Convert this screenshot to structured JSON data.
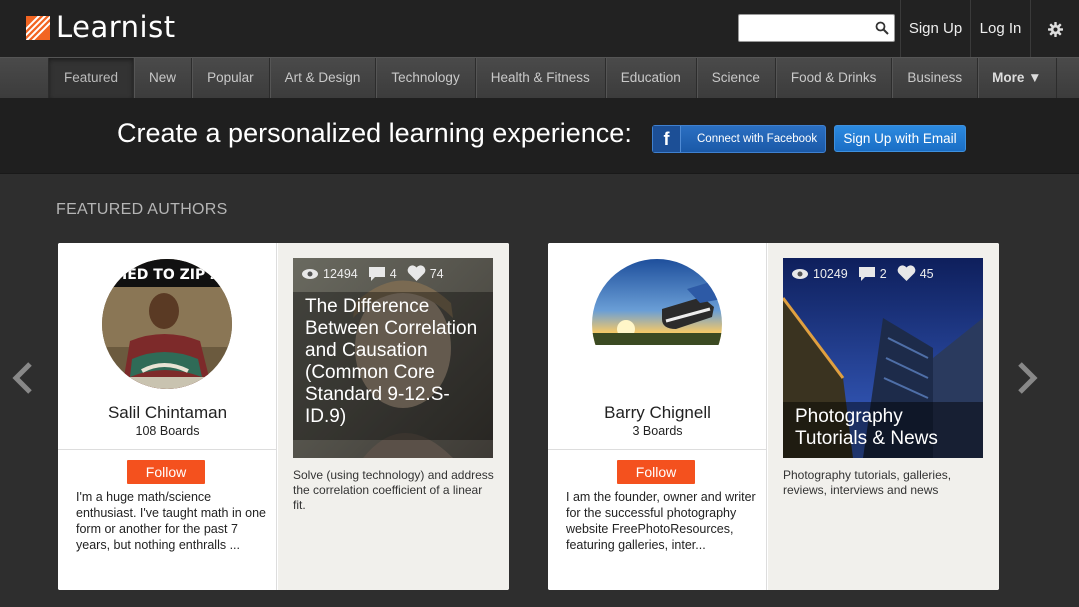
{
  "header": {
    "logo_text": "Learnist",
    "search_placeholder": "",
    "signup": "Sign Up",
    "login": "Log In"
  },
  "nav": {
    "items": [
      "Featured",
      "New",
      "Popular",
      "Art & Design",
      "Technology",
      "Health & Fitness",
      "Education",
      "Science",
      "Food & Drinks",
      "Business"
    ],
    "more": "More ▼",
    "active": "Featured"
  },
  "banner": {
    "text": "Create a personalized learning experience:",
    "facebook": "Connect with Facebook",
    "email": "Sign Up with Email"
  },
  "featured": {
    "title": "FEATURED AUTHORS",
    "authors": [
      {
        "name": "Salil Chintaman",
        "boards": "108 Boards",
        "follow": "Follow",
        "bio": "I'm a huge math/science enthusiast. I've taught math in one form or another for the past 7 years, but nothing enthralls ...",
        "board": {
          "views": "12494",
          "comments": "4",
          "likes": "74",
          "title": "The Difference Between Correlation and Causation (Common Core Standard 9-12.S-ID.9)",
          "desc": "Solve (using technology) and address the correlation coefficient of a linear fit."
        }
      },
      {
        "name": "Barry Chignell",
        "boards": "3 Boards",
        "follow": "Follow",
        "bio": "I am the founder, owner and writer for the successful photography website FreePhotoResources, featuring galleries, inter...",
        "board": {
          "views": "10249",
          "comments": "2",
          "likes": "45",
          "title": "Photography Tutorials & News",
          "desc": "Photography tutorials, galleries, reviews, interviews and news"
        }
      }
    ]
  },
  "colors": {
    "accent": "#f4511e",
    "facebook": "#1a59a8",
    "email_button": "#1a6ec5",
    "background": "#2e2e2e"
  }
}
